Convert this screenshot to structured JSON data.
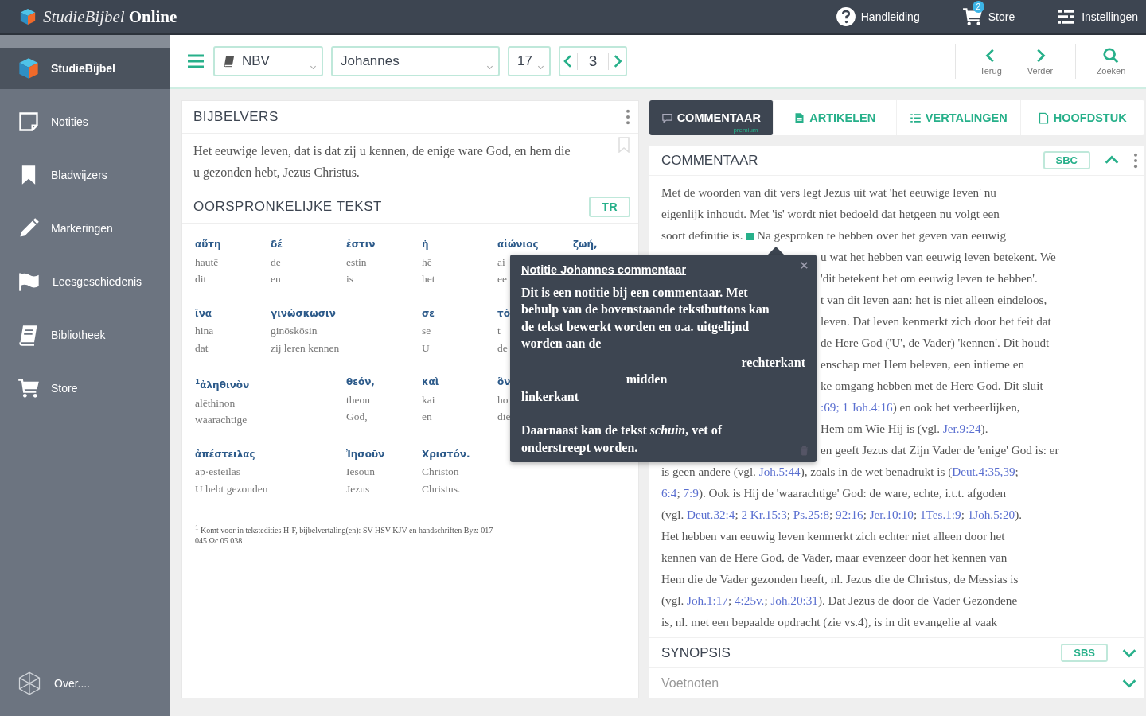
{
  "app": {
    "title_light": "StudieBijbel",
    "title_bold": "Online"
  },
  "topbar": {
    "links": [
      {
        "kind": "help",
        "label": "Handleiding"
      },
      {
        "kind": "store",
        "label": "Store",
        "badge": "2"
      },
      {
        "kind": "settings",
        "label": "Instellingen"
      }
    ]
  },
  "sidebar": {
    "items": [
      {
        "label": "StudieBijbel",
        "selected": true
      },
      {
        "label": "Notities",
        "selected": false
      },
      {
        "label": "Bladwijzers",
        "selected": false
      },
      {
        "label": "Markeringen",
        "selected": false
      },
      {
        "label": "Leesgeschiedenis",
        "selected": false
      },
      {
        "label": "Bibliotheek",
        "selected": false
      },
      {
        "label": "Store",
        "selected": false
      }
    ],
    "footer": {
      "label": "Over...."
    }
  },
  "toolbar": {
    "translation": "NBV",
    "book": "Johannes",
    "chapter": "17",
    "verse": "3",
    "nav": [
      {
        "kind": "back",
        "label": "Terug"
      },
      {
        "kind": "forward",
        "label": "Verder"
      },
      {
        "kind": "search",
        "label": "Zoeken"
      }
    ]
  },
  "verse_panel": {
    "title": "BIJBELVERS",
    "text": "Het eeuwige leven, dat is dat zij u kennen, de enige ware God, en hem die u gezonden hebt, Jezus Christus.",
    "original": {
      "title": "OORSPRONKELIJKE TEKST",
      "source": "TR",
      "rows": [
        [
          {
            "greek": "αὕτη",
            "translit": "hautē",
            "dutch": "dit"
          },
          {
            "greek": "δέ",
            "translit": "de",
            "dutch": "en"
          },
          {
            "greek": "ἐστιν",
            "translit": "estin",
            "dutch": "is"
          },
          {
            "greek": "ἡ",
            "translit": "hē",
            "dutch": "het"
          },
          {
            "greek": "αἰώνιος",
            "translit": "ai",
            "dutch": "ee"
          },
          {
            "greek": "ζωή,"
          }
        ],
        [
          {
            "greek": "ἵνα",
            "translit": "hina",
            "dutch": "dat"
          },
          {
            "greek": "γινώσκωσιν",
            "translit": "ginōskōsin",
            "dutch": "zij leren kennen"
          },
          "",
          {
            "greek": "σε",
            "translit": "se",
            "dutch": "U"
          },
          {
            "greek": "τὸ",
            "translit": "t",
            "dutch": "de"
          }
        ],
        [
          {
            "greek": "$^{1}$ἀληθινὸν",
            "translit": "alēthinon",
            "dutch": "waarachtige"
          },
          "",
          {
            "greek": "θεόν,",
            "translit": "theon",
            "dutch": "God,"
          },
          {
            "greek": "καὶ",
            "translit": "kai",
            "dutch": "en"
          },
          {
            "greek": "ὃν",
            "translit": "ho",
            "dutch": "die"
          }
        ],
        [
          {
            "greek": "ἀπέστειλας",
            "translit": "ap·esteilas",
            "dutch": "U hebt gezonden"
          },
          "",
          {
            "greek": "Ἰησοῦν",
            "translit": "Iēsoun",
            "dutch": "Jezus"
          },
          {
            "greek": "Χριστόν.",
            "translit": "Christon",
            "dutch": "Christus."
          }
        ]
      ],
      "footnote": "$^{1}$ Komt voor in tekstedities H-F, bijbelvertaling(en): SV HSV KJV en handschriften Byz: 017 045 Ωc 05 038"
    }
  },
  "tabs": [
    {
      "kind": "comment",
      "label": "COMMENTAAR",
      "badge": "premium",
      "selected": true
    },
    {
      "kind": "article",
      "label": "ARTIKELEN",
      "selected": false
    },
    {
      "kind": "list",
      "label": "VERTALINGEN",
      "selected": false
    },
    {
      "kind": "page",
      "label": "HOOFDSTUK",
      "selected": false
    }
  ],
  "commentary": {
    "title": "COMMENTAAR",
    "source": "SBC",
    "expanded": true,
    "lines": [
      {
        "kind": "full",
        "runs": [
          {
            "kind": "text",
            "text": "Met de woorden van dit vers legt Jezus uit wat 'het eeuwige leven' nu"
          }
        ]
      },
      {
        "kind": "full",
        "runs": [
          {
            "kind": "text",
            "text": "eigenlijk inhoudt. Met 'is' wordt niet bedoeld dat hetgeen nu volgt een"
          }
        ]
      },
      {
        "kind": "full",
        "runs": [
          {
            "kind": "text",
            "text": "soort definitie is. "
          },
          {
            "kind": "note"
          },
          {
            "kind": "text",
            "text": " Na gesproken te hebben over het geven van eeuwig"
          }
        ]
      },
      {
        "kind": "partial",
        "runs": [
          {
            "kind": "text",
            "text": "u wat het hebben van eeuwig leven betekent. We"
          }
        ]
      },
      {
        "kind": "partial",
        "runs": [
          {
            "kind": "text",
            "text": "'dit betekent het om eeuwig leven te hebben'."
          }
        ]
      },
      {
        "kind": "partial",
        "runs": [
          {
            "kind": "text",
            "text": "t van dit leven aan: het is niet alleen eindeloos,"
          }
        ]
      },
      {
        "kind": "partial",
        "runs": [
          {
            "kind": "text",
            "text": "leven. Dat leven kenmerkt zich door het feit dat"
          }
        ]
      },
      {
        "kind": "partial",
        "runs": [
          {
            "kind": "text",
            "text": "de Here God ('U', de Vader) 'kennen'. Dit houdt"
          }
        ]
      },
      {
        "kind": "partial",
        "runs": [
          {
            "kind": "text",
            "text": "enschap met Hem beleven, een intieme en"
          }
        ]
      },
      {
        "kind": "partial",
        "runs": [
          {
            "kind": "text",
            "text": "ke omgang hebben met de Here God. Dit sluit"
          }
        ]
      },
      {
        "kind": "partial",
        "runs": [
          {
            "kind": "link",
            "text": ":69; 1 Joh.4:16"
          },
          {
            "kind": "text",
            "text": ") en ook het verheerlijken,"
          }
        ]
      },
      {
        "kind": "partial",
        "runs": [
          {
            "kind": "text",
            "text": "Hem om Wie Hij is (vgl. "
          },
          {
            "kind": "link",
            "text": "Jer.9:24"
          },
          {
            "kind": "text",
            "text": ")."
          }
        ]
      },
      {
        "kind": "partial",
        "runs": [
          {
            "kind": "text",
            "text": "en geeft Jezus dat Zijn Vader de 'enige' God is: er"
          }
        ]
      },
      {
        "kind": "full",
        "runs": [
          {
            "kind": "text",
            "text": "is geen andere (vgl. "
          },
          {
            "kind": "link",
            "text": "Joh.5:44"
          },
          {
            "kind": "text",
            "text": "), zoals in de wet benadrukt is ("
          },
          {
            "kind": "link",
            "text": "Deut.4:35,39"
          },
          {
            "kind": "text",
            "text": ";"
          }
        ]
      },
      {
        "kind": "full",
        "runs": [
          {
            "kind": "link",
            "text": "6:4"
          },
          {
            "kind": "text",
            "text": "; "
          },
          {
            "kind": "link",
            "text": "7:9"
          },
          {
            "kind": "text",
            "text": "). Ook is Hij de 'waarachtige' God: de ware, echte, i.t.t. afgoden"
          }
        ]
      },
      {
        "kind": "full",
        "runs": [
          {
            "kind": "text",
            "text": "(vgl. "
          },
          {
            "kind": "link",
            "text": "Deut.32:4"
          },
          {
            "kind": "text",
            "text": "; "
          },
          {
            "kind": "link",
            "text": "2 Kr.15:3"
          },
          {
            "kind": "text",
            "text": "; "
          },
          {
            "kind": "link",
            "text": "Ps.25:8"
          },
          {
            "kind": "text",
            "text": "; "
          },
          {
            "kind": "link",
            "text": "92:16"
          },
          {
            "kind": "text",
            "text": "; "
          },
          {
            "kind": "link",
            "text": "Jer.10:10"
          },
          {
            "kind": "text",
            "text": "; "
          },
          {
            "kind": "link",
            "text": "1Tes.1:9"
          },
          {
            "kind": "text",
            "text": "; "
          },
          {
            "kind": "link",
            "text": "1Joh.5:20"
          },
          {
            "kind": "text",
            "text": ")."
          }
        ]
      },
      {
        "kind": "full",
        "runs": [
          {
            "kind": "text",
            "text": "Het hebben van eeuwig leven kenmerkt zich echter niet alleen door het"
          }
        ]
      },
      {
        "kind": "full",
        "runs": [
          {
            "kind": "text",
            "text": "kennen van de Here God, de Vader, maar evenzeer door het kennen van"
          }
        ]
      },
      {
        "kind": "full",
        "runs": [
          {
            "kind": "text",
            "text": "Hem die de Vader gezonden heeft, nl. Jezus die de Christus, de Messias is"
          }
        ]
      },
      {
        "kind": "full",
        "runs": [
          {
            "kind": "text",
            "text": "(vgl. "
          },
          {
            "kind": "link",
            "text": "Joh.1:17"
          },
          {
            "kind": "text",
            "text": "; "
          },
          {
            "kind": "link",
            "text": "4:25v."
          },
          {
            "kind": "text",
            "text": "; "
          },
          {
            "kind": "link",
            "text": "Joh.20:31"
          },
          {
            "kind": "text",
            "text": "). Dat Jezus de door de Vader Gezondene"
          }
        ]
      },
      {
        "kind": "full",
        "runs": [
          {
            "kind": "text",
            "text": "is, nl. met een bepaalde opdracht (zie vs.4), is in dit evangelie al vaak"
          }
        ]
      }
    ]
  },
  "synopsis": {
    "title": "SYNOPSIS",
    "source": "SBS",
    "expanded": false
  },
  "footnotes": {
    "title": "Voetnoten",
    "expanded": false
  },
  "note_popup": {
    "title": "Notitie Johannes commentaar",
    "blocks": [
      {
        "kind": "paragraph",
        "runs": [
          {
            "kind": "text",
            "text": "Dit is een notitie bij een commentaar. Met behulp van de bovenstaande tekstbuttons kan de tekst bewerkt worden en o.a. uitgelijnd worden aan de"
          }
        ]
      },
      {
        "kind": "right",
        "runs": [
          {
            "kind": "link",
            "text": "rechterkant"
          }
        ]
      },
      {
        "kind": "center",
        "runs": [
          {
            "kind": "text",
            "text": "midden"
          }
        ]
      },
      {
        "kind": "left",
        "runs": [
          {
            "kind": "text",
            "text": "linkerkant"
          }
        ]
      },
      {
        "kind": "paragraph",
        "runs": [
          {
            "kind": "text",
            "text": "Daarnaast kan de tekst *schuin*, vet of "
          },
          {
            "kind": "link",
            "text": "onderstreept"
          },
          {
            "kind": "text",
            "text": " worden."
          }
        ]
      }
    ]
  }
}
